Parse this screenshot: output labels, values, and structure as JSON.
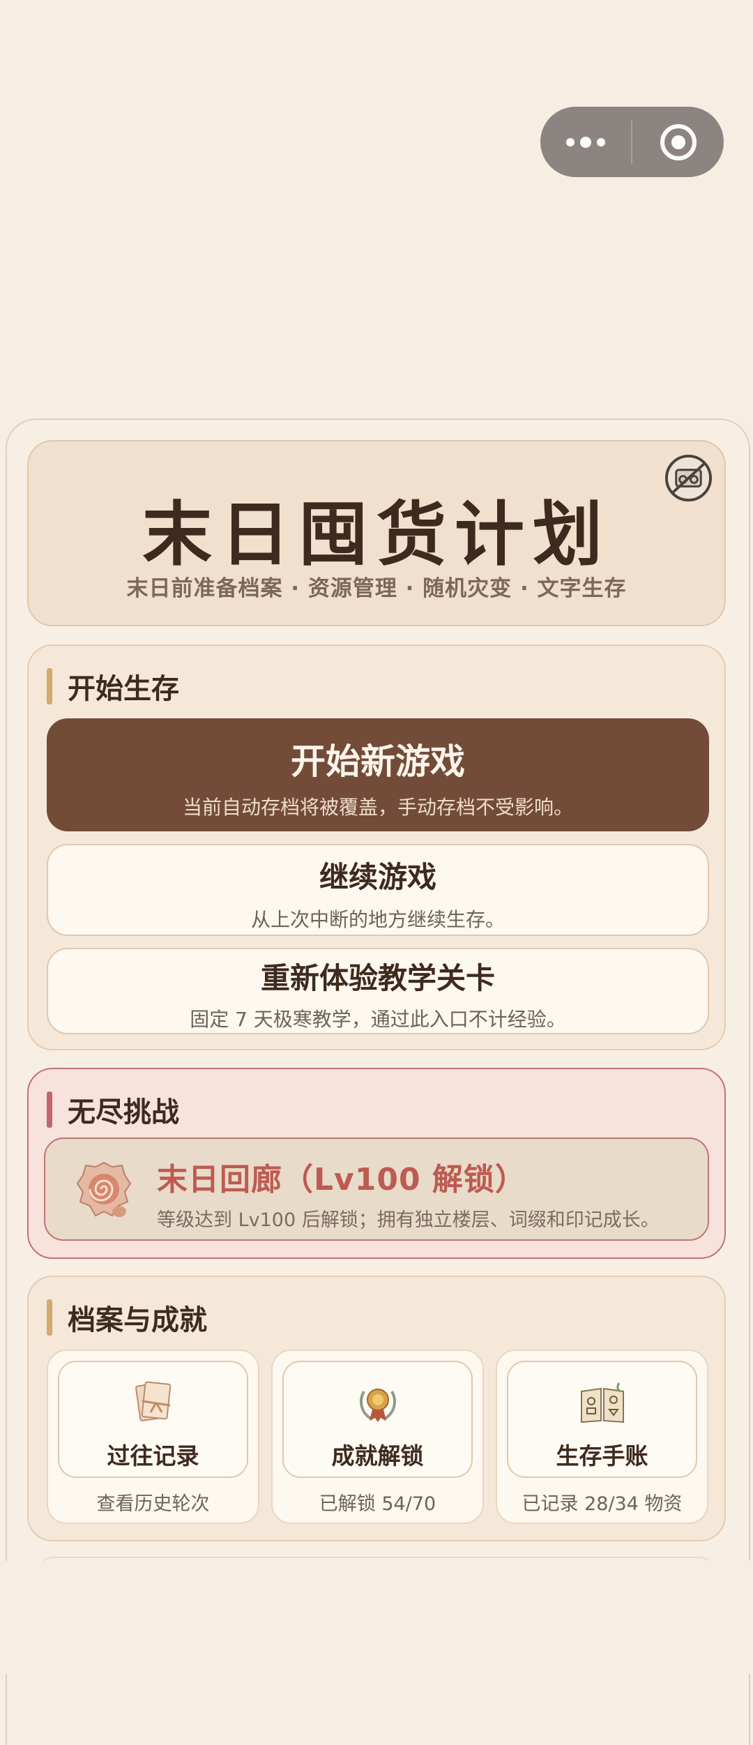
{
  "title_card": {
    "title": "末日囤货计划",
    "subtitle": "末日前准备档案 · 资源管理 · 随机灾变 · 文字生存"
  },
  "start_section": {
    "heading": "开始生存",
    "new_game": {
      "label": "开始新游戏",
      "desc": "当前自动存档将被覆盖，手动存档不受影响。"
    },
    "continue_game": {
      "label": "继续游戏",
      "desc": "从上次中断的地方继续生存。"
    },
    "tutorial": {
      "label": "重新体验教学关卡",
      "desc": "固定 7 天极寒教学，通过此入口不计经验。"
    }
  },
  "endless_section": {
    "heading": "无尽挑战",
    "corridor": {
      "label": "末日回廊（Lv100 解锁）",
      "desc": "等级达到 Lv100 后解锁；拥有独立楼层、词缀和印记成长。"
    }
  },
  "archive_section": {
    "heading": "档案与成就",
    "tiles": [
      {
        "label": "过往记录",
        "desc": "查看历史轮次",
        "icon": "records-bundle-icon"
      },
      {
        "label": "成就解锁",
        "desc": "已解锁 54/70",
        "icon": "medal-icon"
      },
      {
        "label": "生存手账",
        "desc": "已记录 28/34 物资",
        "icon": "journal-book-icon"
      }
    ]
  },
  "colors": {
    "background": "#f6eee3",
    "primary_button": "#724b39",
    "accent_bar": "#d4a86f",
    "danger_accent": "#c0676d"
  }
}
